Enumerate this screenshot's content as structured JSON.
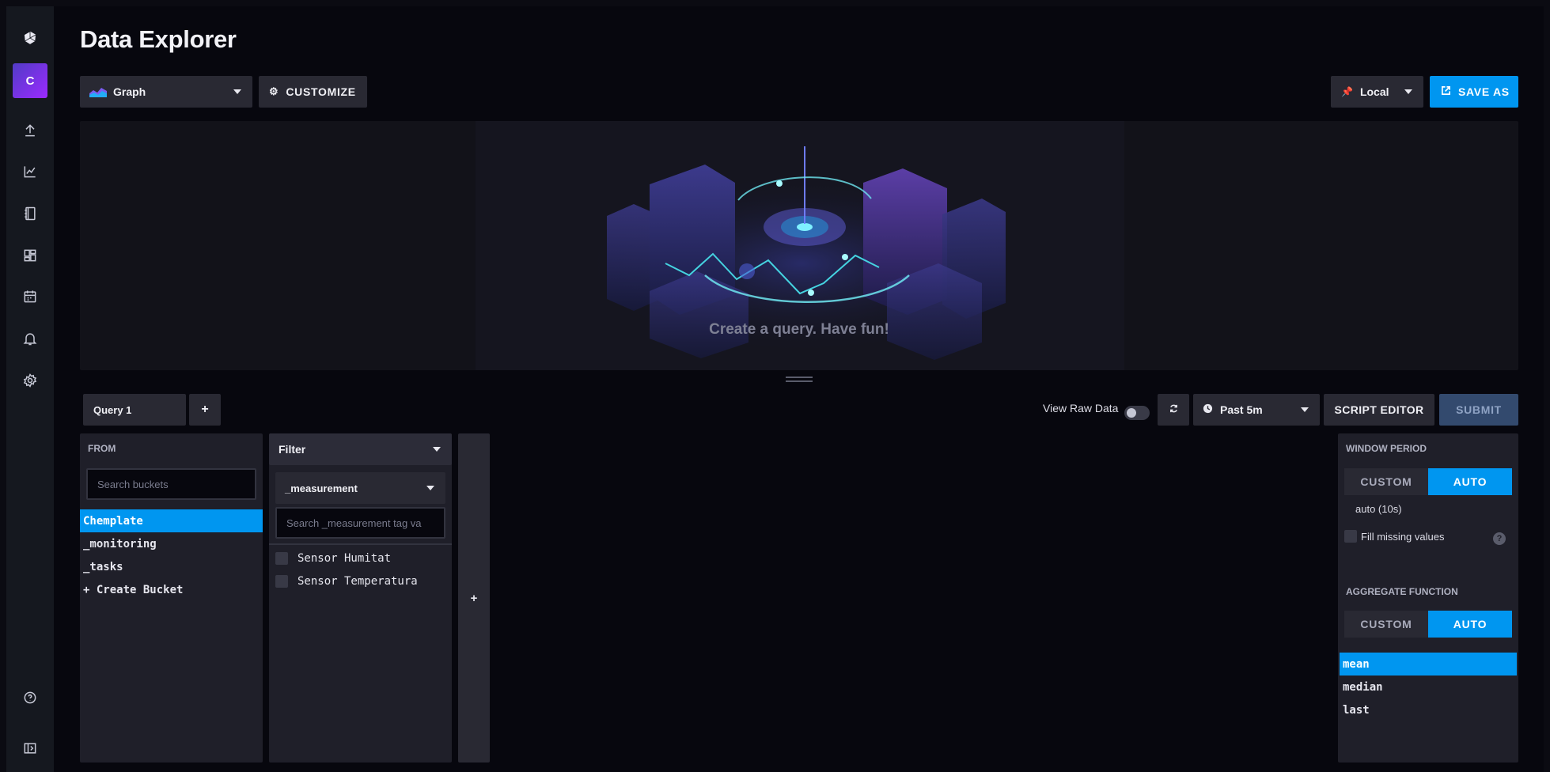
{
  "page": {
    "title": "Data Explorer"
  },
  "nav": {
    "org_initial": "C",
    "items": [
      {
        "name": "upload"
      },
      {
        "name": "graph"
      },
      {
        "name": "notebook"
      },
      {
        "name": "dashboards"
      },
      {
        "name": "tasks"
      },
      {
        "name": "alerts"
      },
      {
        "name": "settings"
      }
    ],
    "bottom": [
      {
        "name": "help"
      },
      {
        "name": "collapse"
      }
    ]
  },
  "toolbar": {
    "vis_type": "Graph",
    "customize": "CUSTOMIZE",
    "timezone": "Local",
    "save_as": "SAVE AS"
  },
  "graph": {
    "empty_message": "Create a query. Have fun!"
  },
  "query": {
    "tab": "Query 1",
    "add": "+",
    "view_raw": "View Raw Data",
    "view_raw_on": false,
    "time_range": "Past 5m",
    "script_editor": "SCRIPT EDITOR",
    "submit": "SUBMIT"
  },
  "from": {
    "label": "FROM",
    "search_placeholder": "Search buckets",
    "buckets": [
      "Chemplate",
      "_monitoring",
      "_tasks",
      "+ Create Bucket"
    ],
    "selected": "Chemplate"
  },
  "filter": {
    "label": "Filter",
    "key": "_measurement",
    "search_placeholder": "Search _measurement tag va",
    "values": [
      "Sensor Humitat",
      "Sensor Temperatura"
    ]
  },
  "add_filter": "+",
  "aggregate": {
    "window_label": "WINDOW PERIOD",
    "custom": "CUSTOM",
    "auto": "AUTO",
    "window_value": "auto (10s)",
    "fill_missing": "Fill missing values",
    "help": "?",
    "function_label": "AGGREGATE FUNCTION",
    "functions": [
      "mean",
      "median",
      "last"
    ],
    "selected": "mean"
  },
  "colors": {
    "accent": "#0096f0",
    "background": "#07070e",
    "panel": "#1f1f29"
  }
}
